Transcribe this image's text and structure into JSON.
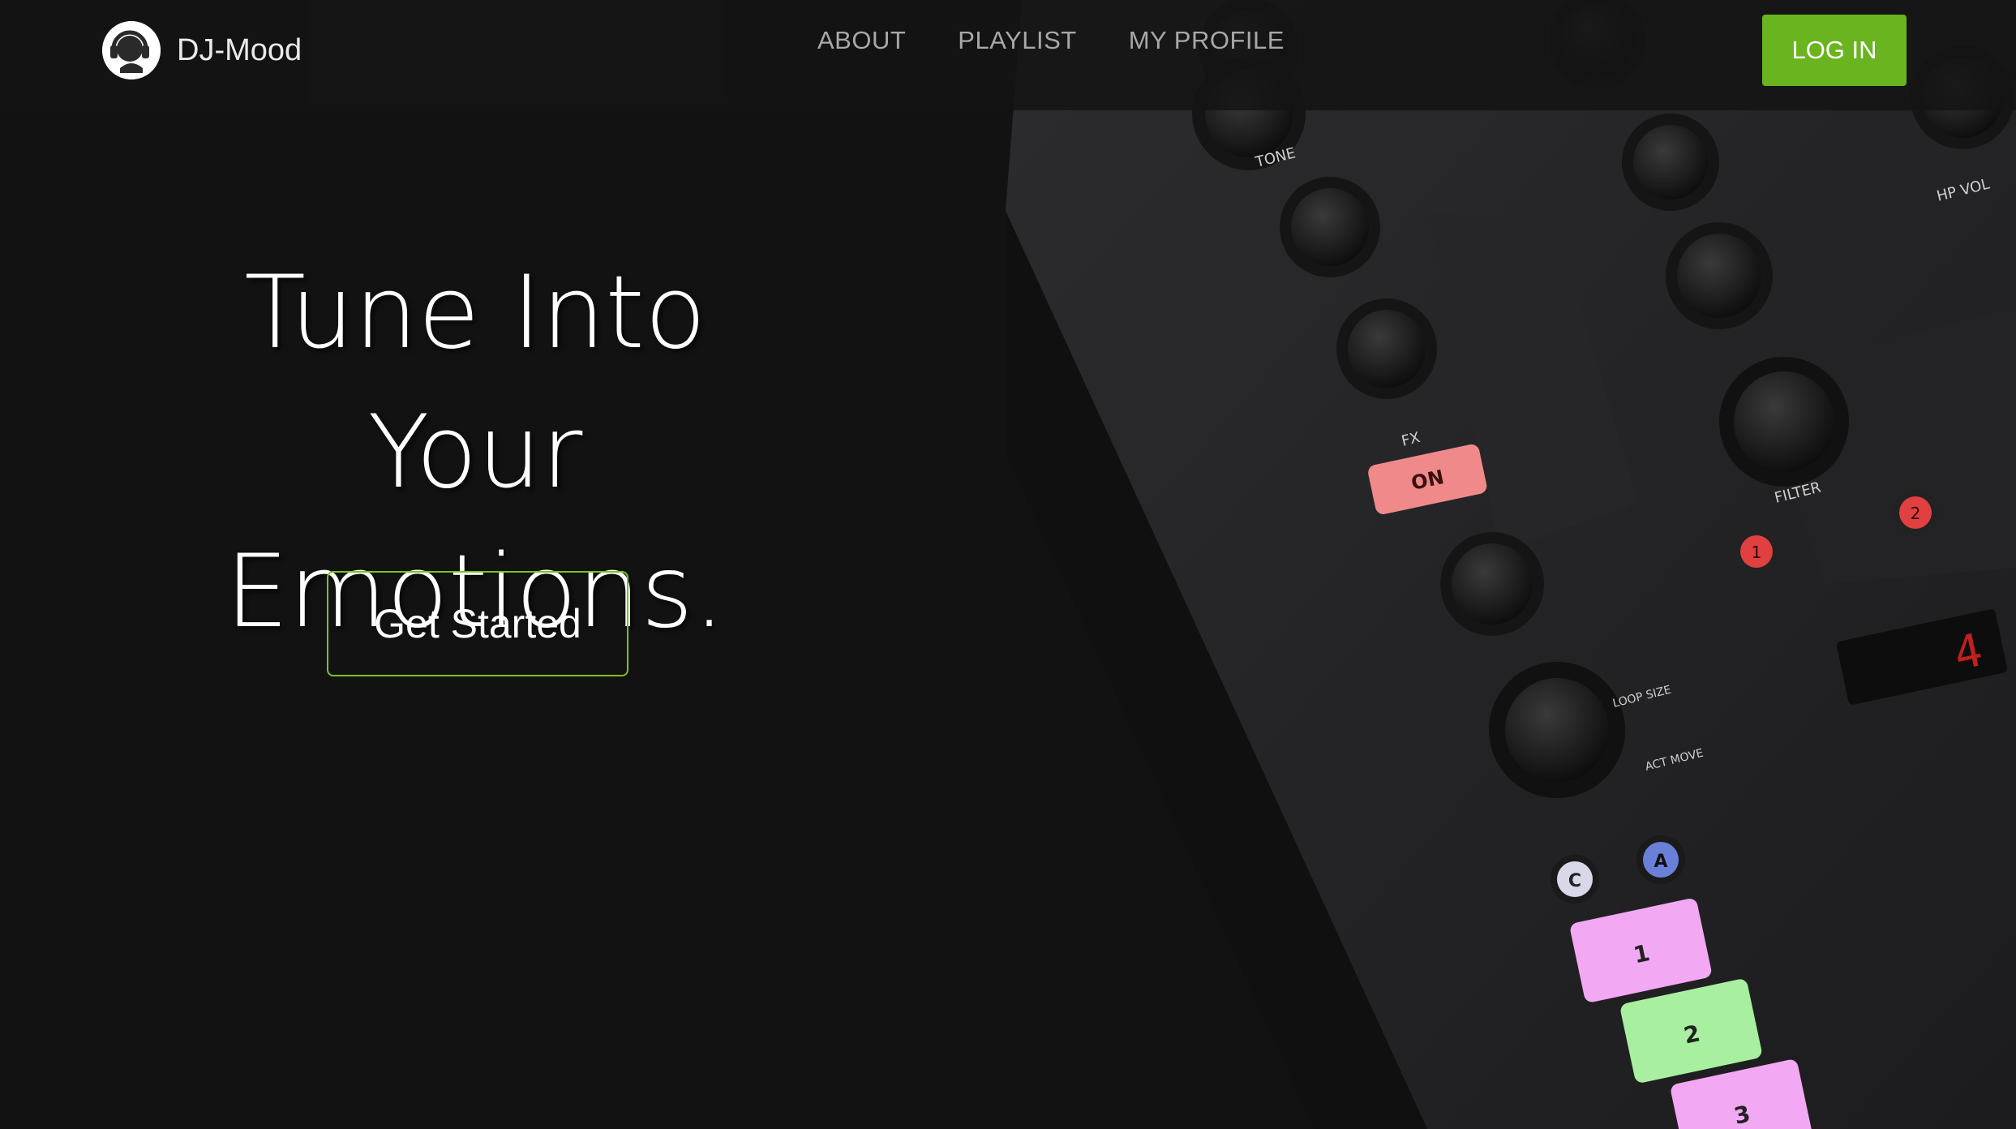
{
  "brand": {
    "name": "DJ-Mood",
    "logo_icon": "dj-headphones-logo-icon"
  },
  "nav": {
    "links": [
      {
        "label": "ABOUT"
      },
      {
        "label": "PLAYLIST"
      },
      {
        "label": "MY PROFILE"
      }
    ],
    "login_label": "LOG IN"
  },
  "hero": {
    "title_line1": "Tune Into",
    "title_line2": "Your Emotions.",
    "cta_label": "Get Started"
  },
  "mixer": {
    "knob_labels": [
      "TONE",
      "FX",
      "FILTER",
      "HP VOL",
      "LOOP SIZE",
      "ACT MOVE"
    ],
    "on_button": "ON",
    "fx_buttons": [
      "1",
      "2"
    ],
    "deck_buttons": [
      "C",
      "A"
    ],
    "pads": [
      "1",
      "2",
      "3"
    ],
    "display_digit": "4"
  },
  "colors": {
    "accent": "#6ab41f",
    "cta_border": "#7cc21f",
    "background": "#121212"
  }
}
